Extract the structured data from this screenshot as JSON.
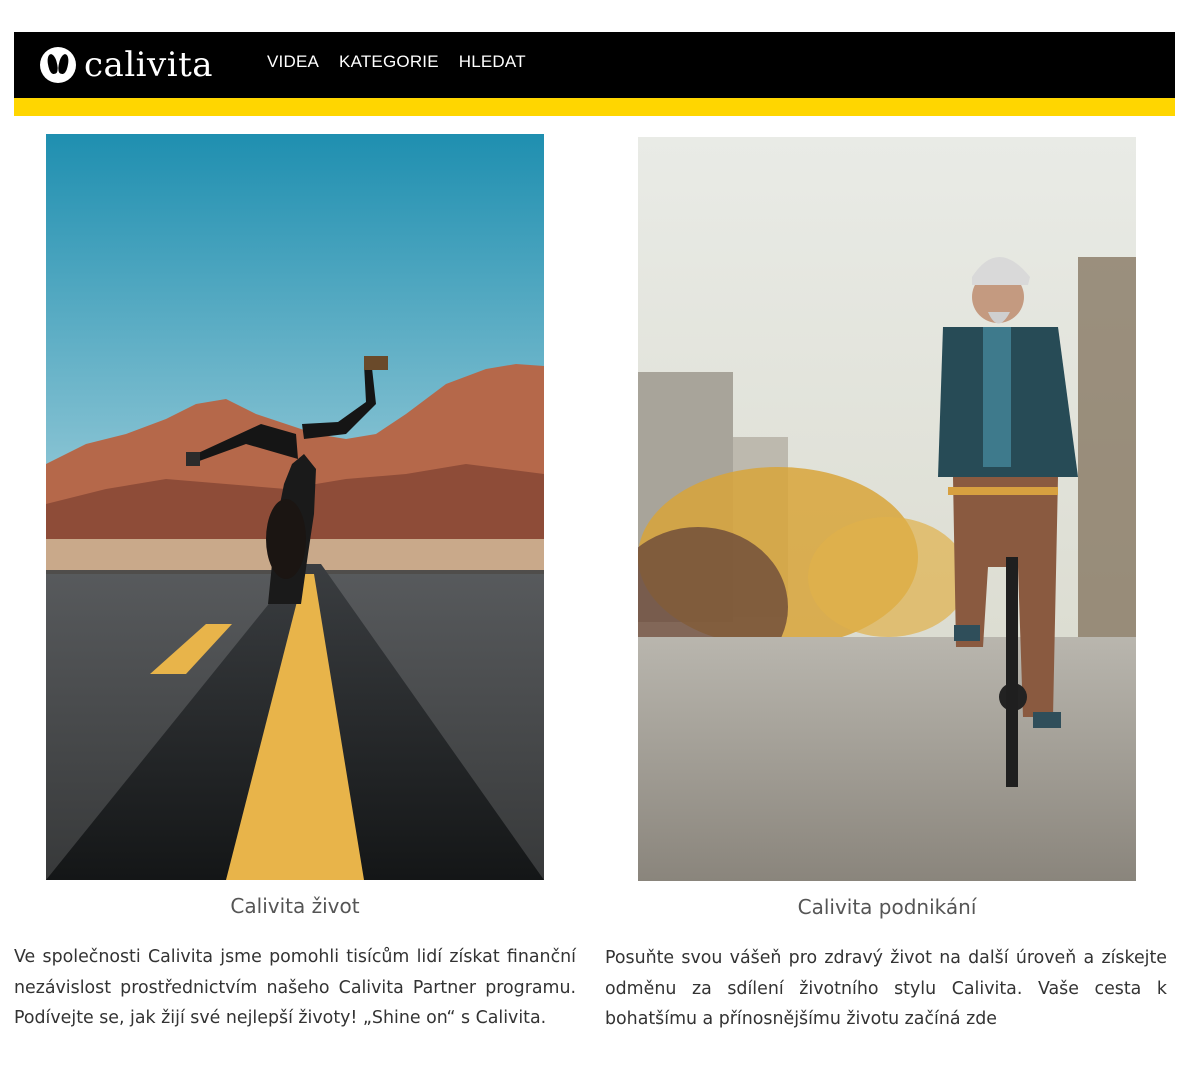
{
  "header": {
    "logo_text": "calivita",
    "nav": [
      "VIDEA",
      "KATEGORIE",
      "HLEDAT"
    ],
    "colors": {
      "bar": "#000000",
      "accent": "#ffd600"
    }
  },
  "cards": [
    {
      "caption": "Calivita život",
      "description": "Ve společnosti Calivita jsme pomohli tisícům lidí získat finanční nezávislost prostřednictvím našeho Calivita Partner programu. Podívejte se, jak žijí své nejlepší životy! „Shine on“ s Calivita."
    },
    {
      "caption": "Calivita podnikání",
      "description": "Posuňte svou vášeň pro zdravý život na další úroveň a získejte odměnu za sdílení životního stylu Calivita. Vaše cesta k bohatšímu a přínosnějšímu životu začíná zde"
    }
  ]
}
